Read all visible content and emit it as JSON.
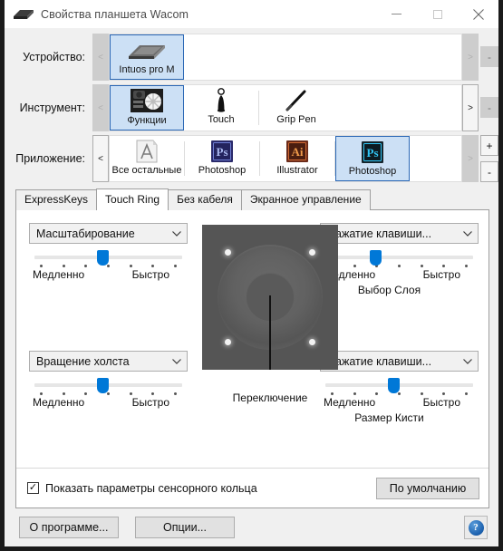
{
  "window": {
    "title": "Свойства планшета Wacom",
    "icon": "wacom-tablet-icon",
    "minimize": "—",
    "maximize": "▢",
    "close": "✕"
  },
  "selectors": {
    "device": {
      "label": "Устройство:",
      "prev": "<",
      "next": ">",
      "minus": "-",
      "items": [
        {
          "label": "Intuos pro M",
          "icon": "tablet-icon",
          "selected": true
        }
      ]
    },
    "tool": {
      "label": "Инструмент:",
      "prev": "<",
      "next": ">",
      "minus": "-",
      "items": [
        {
          "label": "Функции",
          "icon": "functions-icon",
          "selected": true
        },
        {
          "label": "Touch",
          "icon": "touch-finger-icon",
          "selected": false
        },
        {
          "label": "Grip Pen",
          "icon": "grip-pen-icon",
          "selected": false
        }
      ]
    },
    "application": {
      "label": "Приложение:",
      "prev": "<",
      "next": ">",
      "plus": "+",
      "minus": "-",
      "items": [
        {
          "label": "Все остальные",
          "icon": "all-other-apps-icon",
          "selected": false
        },
        {
          "label": "Photoshop",
          "icon": "photoshop-icon",
          "selected": false
        },
        {
          "label": "Illustrator",
          "icon": "illustrator-icon",
          "selected": false
        },
        {
          "label": "Photoshop",
          "icon": "photoshop-cc-icon",
          "selected": true
        }
      ]
    }
  },
  "tabs": [
    {
      "label": "ExpressKeys",
      "active": false
    },
    {
      "label": "Touch Ring",
      "active": true
    },
    {
      "label": "Без кабеля",
      "active": false
    },
    {
      "label": "Экранное управление",
      "active": false
    }
  ],
  "controls": {
    "top_left": {
      "combo_value": "Масштабирование",
      "chevron": "⌄",
      "slider_percent": 46,
      "slow_label": "Медленно",
      "fast_label": "Быстро",
      "caption": ""
    },
    "top_right": {
      "combo_value": "Нажатие клавиши...",
      "chevron": "⌄",
      "slider_percent": 34,
      "slow_label": "Медленно",
      "fast_label": "Быстро",
      "caption": "Выбор Слоя"
    },
    "bottom_left": {
      "combo_value": "Вращение холста",
      "chevron": "⌄",
      "slider_percent": 46,
      "slow_label": "Медленно",
      "fast_label": "Быстро",
      "caption": ""
    },
    "bottom_right": {
      "combo_value": "Нажатие клавиши...",
      "chevron": "⌄",
      "slider_percent": 46,
      "slow_label": "Медленно",
      "fast_label": "Быстро",
      "caption": "Размер Кисти"
    }
  },
  "ring": {
    "caption": "Переключение",
    "led_count": 4
  },
  "footer_tab": {
    "checkbox_label": "Показать параметры сенсорного кольца",
    "checkbox_checked": true,
    "check_glyph": "✓",
    "default_button": "По умолчанию"
  },
  "footer_window": {
    "about_button": "О программе...",
    "options_button": "Опции...",
    "help_glyph": "?"
  },
  "colors": {
    "accent": "#0078d7",
    "selection_fill": "#cce0f5",
    "selection_border": "#2a67b5",
    "window_bg": "#f0f0f0",
    "panel_bg": "#ffffff",
    "ring_bg": "#555555"
  }
}
